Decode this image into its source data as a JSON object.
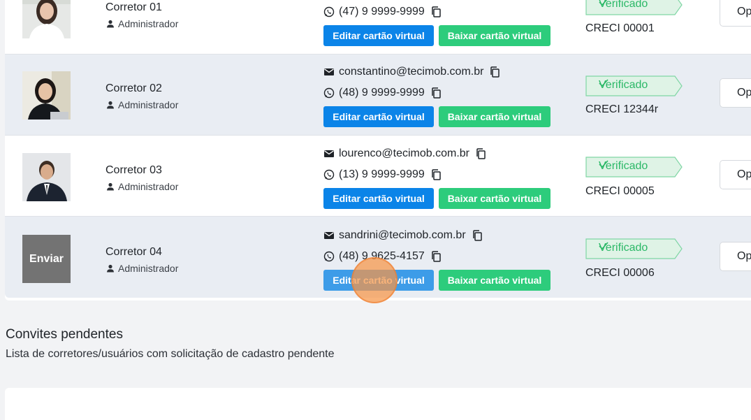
{
  "brokers": [
    {
      "name": "Corretor 01",
      "role": "Administrador",
      "email": "",
      "phone": "(47) 9 9999-9999",
      "edit_label": "Editar cartão virtual",
      "download_label": "Baixar cartão virtual",
      "badge": "Verificado",
      "creci": "CRECI 00001",
      "options_label": "Op"
    },
    {
      "name": "Corretor 02",
      "role": "Administrador",
      "email": "constantino@tecimob.com.br",
      "phone": "(48) 9 9999-9999",
      "edit_label": "Editar cartão virtual",
      "download_label": "Baixar cartão virtual",
      "badge": "Verificado",
      "creci": "CRECI 12344r",
      "options_label": "Op"
    },
    {
      "name": "Corretor 03",
      "role": "Administrador",
      "email": "lourenco@tecimob.com.br",
      "phone": "(13) 9 9999-9999",
      "edit_label": "Editar cartão virtual",
      "download_label": "Baixar cartão virtual",
      "badge": "Verificado",
      "creci": "CRECI 00005",
      "options_label": "Op"
    },
    {
      "name": "Corretor 04",
      "role": "Administrador",
      "avatar_upload_label": "Enviar",
      "email": "sandrini@tecimob.com.br",
      "phone": "(48) 9 9625-4157",
      "edit_label": "Editar cartão virtual",
      "download_label": "Baixar cartão virtual",
      "badge": "Verificado",
      "creci": "CRECI 00006",
      "options_label": "Op"
    }
  ],
  "pending_invites": {
    "title": "Convites pendentes",
    "subtitle": "Lista de corretores/usuários com solicitação de cadastro pendente"
  },
  "colors": {
    "primary_blue": "#0b84e8",
    "success_green": "#2dcc7c",
    "verified_green": "#2bb867",
    "row_alt_bg": "#e9edf3"
  },
  "icons": {
    "role": "person-icon",
    "email": "envelope-icon",
    "phone": "whatsapp-icon",
    "copy": "copy-icon",
    "verified": "check-icon"
  }
}
